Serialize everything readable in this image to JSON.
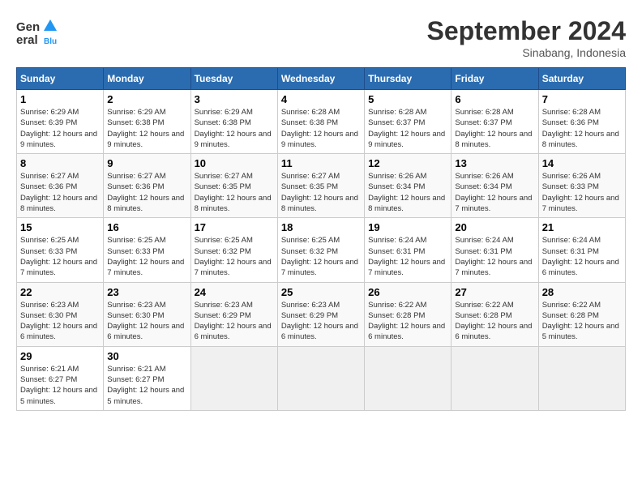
{
  "logo": {
    "line1": "General",
    "line2": "Blue"
  },
  "title": "September 2024",
  "location": "Sinabang, Indonesia",
  "days_of_week": [
    "Sunday",
    "Monday",
    "Tuesday",
    "Wednesday",
    "Thursday",
    "Friday",
    "Saturday"
  ],
  "weeks": [
    [
      {
        "day": "1",
        "sunrise": "Sunrise: 6:29 AM",
        "sunset": "Sunset: 6:39 PM",
        "daylight": "Daylight: 12 hours and 9 minutes."
      },
      {
        "day": "2",
        "sunrise": "Sunrise: 6:29 AM",
        "sunset": "Sunset: 6:38 PM",
        "daylight": "Daylight: 12 hours and 9 minutes."
      },
      {
        "day": "3",
        "sunrise": "Sunrise: 6:29 AM",
        "sunset": "Sunset: 6:38 PM",
        "daylight": "Daylight: 12 hours and 9 minutes."
      },
      {
        "day": "4",
        "sunrise": "Sunrise: 6:28 AM",
        "sunset": "Sunset: 6:38 PM",
        "daylight": "Daylight: 12 hours and 9 minutes."
      },
      {
        "day": "5",
        "sunrise": "Sunrise: 6:28 AM",
        "sunset": "Sunset: 6:37 PM",
        "daylight": "Daylight: 12 hours and 9 minutes."
      },
      {
        "day": "6",
        "sunrise": "Sunrise: 6:28 AM",
        "sunset": "Sunset: 6:37 PM",
        "daylight": "Daylight: 12 hours and 8 minutes."
      },
      {
        "day": "7",
        "sunrise": "Sunrise: 6:28 AM",
        "sunset": "Sunset: 6:36 PM",
        "daylight": "Daylight: 12 hours and 8 minutes."
      }
    ],
    [
      {
        "day": "8",
        "sunrise": "Sunrise: 6:27 AM",
        "sunset": "Sunset: 6:36 PM",
        "daylight": "Daylight: 12 hours and 8 minutes."
      },
      {
        "day": "9",
        "sunrise": "Sunrise: 6:27 AM",
        "sunset": "Sunset: 6:36 PM",
        "daylight": "Daylight: 12 hours and 8 minutes."
      },
      {
        "day": "10",
        "sunrise": "Sunrise: 6:27 AM",
        "sunset": "Sunset: 6:35 PM",
        "daylight": "Daylight: 12 hours and 8 minutes."
      },
      {
        "day": "11",
        "sunrise": "Sunrise: 6:27 AM",
        "sunset": "Sunset: 6:35 PM",
        "daylight": "Daylight: 12 hours and 8 minutes."
      },
      {
        "day": "12",
        "sunrise": "Sunrise: 6:26 AM",
        "sunset": "Sunset: 6:34 PM",
        "daylight": "Daylight: 12 hours and 8 minutes."
      },
      {
        "day": "13",
        "sunrise": "Sunrise: 6:26 AM",
        "sunset": "Sunset: 6:34 PM",
        "daylight": "Daylight: 12 hours and 7 minutes."
      },
      {
        "day": "14",
        "sunrise": "Sunrise: 6:26 AM",
        "sunset": "Sunset: 6:33 PM",
        "daylight": "Daylight: 12 hours and 7 minutes."
      }
    ],
    [
      {
        "day": "15",
        "sunrise": "Sunrise: 6:25 AM",
        "sunset": "Sunset: 6:33 PM",
        "daylight": "Daylight: 12 hours and 7 minutes."
      },
      {
        "day": "16",
        "sunrise": "Sunrise: 6:25 AM",
        "sunset": "Sunset: 6:33 PM",
        "daylight": "Daylight: 12 hours and 7 minutes."
      },
      {
        "day": "17",
        "sunrise": "Sunrise: 6:25 AM",
        "sunset": "Sunset: 6:32 PM",
        "daylight": "Daylight: 12 hours and 7 minutes."
      },
      {
        "day": "18",
        "sunrise": "Sunrise: 6:25 AM",
        "sunset": "Sunset: 6:32 PM",
        "daylight": "Daylight: 12 hours and 7 minutes."
      },
      {
        "day": "19",
        "sunrise": "Sunrise: 6:24 AM",
        "sunset": "Sunset: 6:31 PM",
        "daylight": "Daylight: 12 hours and 7 minutes."
      },
      {
        "day": "20",
        "sunrise": "Sunrise: 6:24 AM",
        "sunset": "Sunset: 6:31 PM",
        "daylight": "Daylight: 12 hours and 7 minutes."
      },
      {
        "day": "21",
        "sunrise": "Sunrise: 6:24 AM",
        "sunset": "Sunset: 6:31 PM",
        "daylight": "Daylight: 12 hours and 6 minutes."
      }
    ],
    [
      {
        "day": "22",
        "sunrise": "Sunrise: 6:23 AM",
        "sunset": "Sunset: 6:30 PM",
        "daylight": "Daylight: 12 hours and 6 minutes."
      },
      {
        "day": "23",
        "sunrise": "Sunrise: 6:23 AM",
        "sunset": "Sunset: 6:30 PM",
        "daylight": "Daylight: 12 hours and 6 minutes."
      },
      {
        "day": "24",
        "sunrise": "Sunrise: 6:23 AM",
        "sunset": "Sunset: 6:29 PM",
        "daylight": "Daylight: 12 hours and 6 minutes."
      },
      {
        "day": "25",
        "sunrise": "Sunrise: 6:23 AM",
        "sunset": "Sunset: 6:29 PM",
        "daylight": "Daylight: 12 hours and 6 minutes."
      },
      {
        "day": "26",
        "sunrise": "Sunrise: 6:22 AM",
        "sunset": "Sunset: 6:28 PM",
        "daylight": "Daylight: 12 hours and 6 minutes."
      },
      {
        "day": "27",
        "sunrise": "Sunrise: 6:22 AM",
        "sunset": "Sunset: 6:28 PM",
        "daylight": "Daylight: 12 hours and 6 minutes."
      },
      {
        "day": "28",
        "sunrise": "Sunrise: 6:22 AM",
        "sunset": "Sunset: 6:28 PM",
        "daylight": "Daylight: 12 hours and 5 minutes."
      }
    ],
    [
      {
        "day": "29",
        "sunrise": "Sunrise: 6:21 AM",
        "sunset": "Sunset: 6:27 PM",
        "daylight": "Daylight: 12 hours and 5 minutes."
      },
      {
        "day": "30",
        "sunrise": "Sunrise: 6:21 AM",
        "sunset": "Sunset: 6:27 PM",
        "daylight": "Daylight: 12 hours and 5 minutes."
      },
      null,
      null,
      null,
      null,
      null
    ]
  ]
}
